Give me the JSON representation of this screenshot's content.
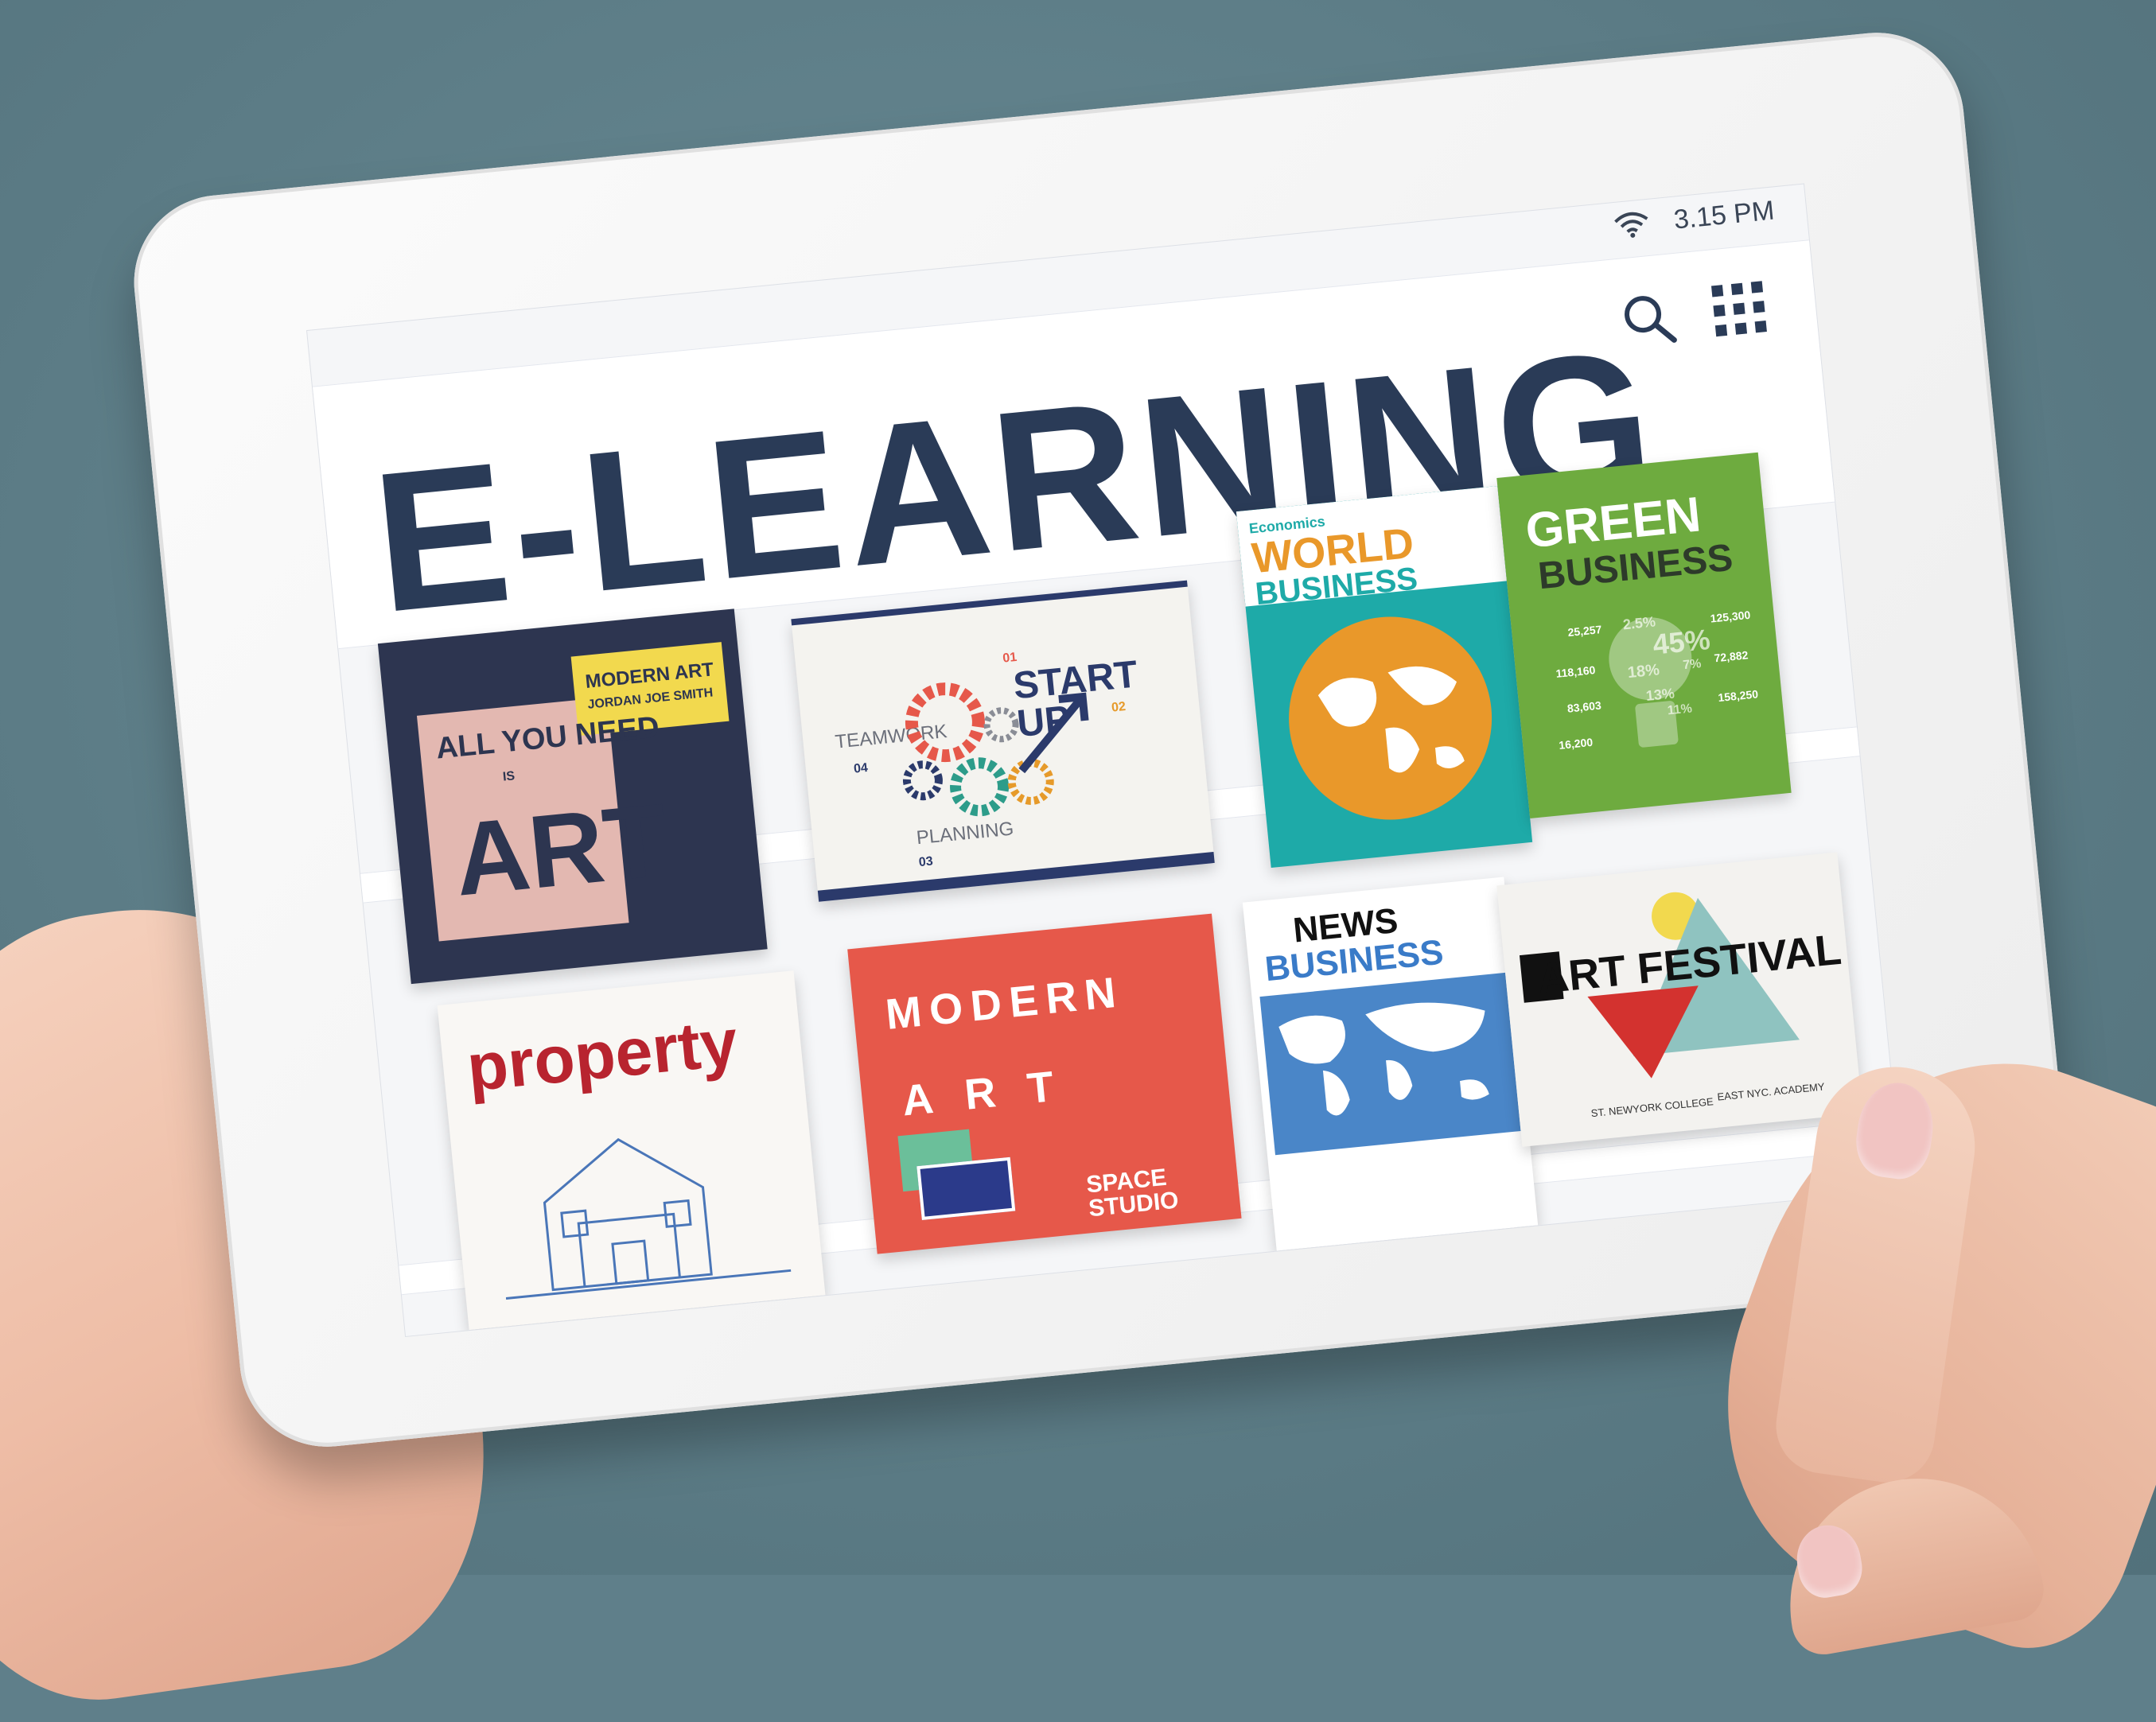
{
  "status_bar": {
    "time": "3.15 PM",
    "wifi_icon": "wifi-icon"
  },
  "header": {
    "title": "E-LEARNING",
    "search_icon": "search-icon",
    "menu_icon": "grid-icon"
  },
  "courses": [
    {
      "title_lines": [
        "ALL YOU NEED",
        "IS",
        "ART"
      ],
      "tag": "MODERN ART",
      "author": "JORDAN JOE SMITH"
    },
    {
      "title": "START UP",
      "labels": [
        "TEAMWORK",
        "PLANNING"
      ],
      "numbers": [
        "01",
        "02",
        "03",
        "04"
      ]
    },
    {
      "kicker": "Economics",
      "title_lines": [
        "WORLD",
        "BUSINESS"
      ]
    },
    {
      "title_lines": [
        "GREEN",
        "BUSINESS"
      ],
      "stats": [
        "25,257",
        "125,300",
        "118,160",
        "72,882",
        "83,603",
        "158,250",
        "16,200"
      ],
      "percents": [
        "2.5%",
        "45%",
        "18%",
        "7%",
        "13%",
        "11%"
      ]
    },
    {
      "title": "property"
    },
    {
      "title_lines": [
        "MODERN",
        "ART"
      ],
      "subtitle": "SPACE STUDIO"
    },
    {
      "title_lines": [
        "NEWS",
        "BUSINESS"
      ]
    },
    {
      "title": "ART FESTIVAL",
      "footer": [
        "ST. NEWYORK COLLEGE",
        "EAST NYC. ACADEMY"
      ]
    }
  ],
  "colors": {
    "background": "#5f7f8a",
    "title": "#2a3b57",
    "accent_yellow": "#f2d94e",
    "accent_red": "#e6584a",
    "accent_teal": "#1eaaa8",
    "accent_green": "#6eab3f"
  }
}
